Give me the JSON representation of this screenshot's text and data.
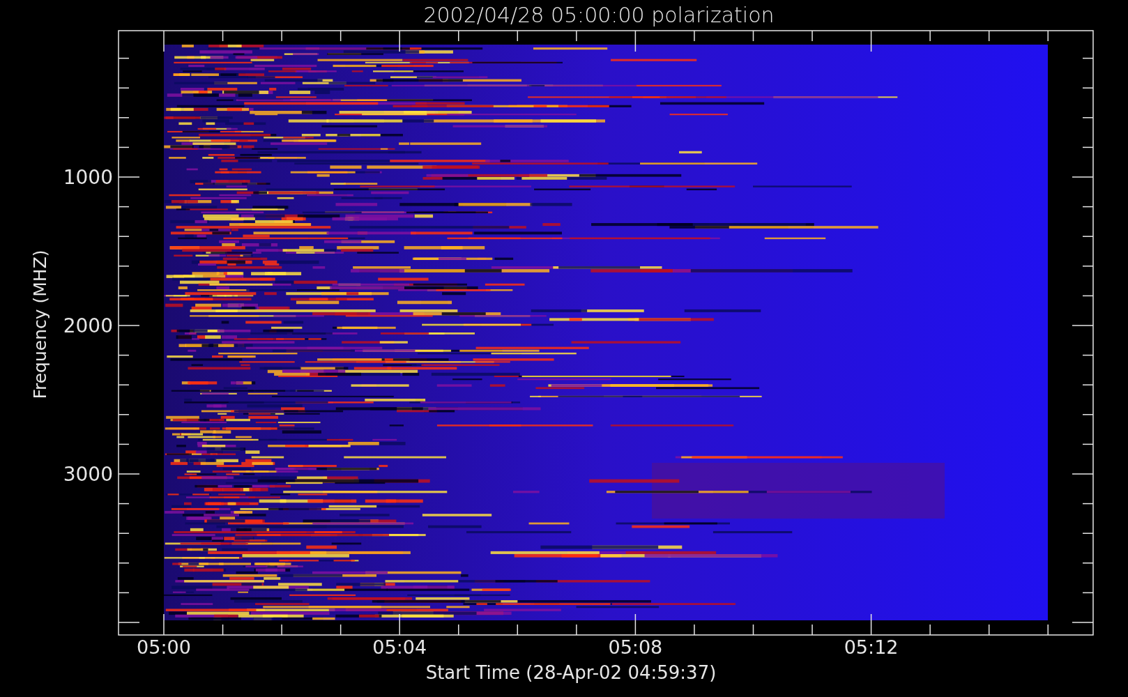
{
  "title": "2002/04/28 05:00:00 polarization",
  "y_axis": {
    "label": "Frequency (MHZ)",
    "ticks": [
      "1000",
      "2000",
      "3000"
    ]
  },
  "x_axis": {
    "label": "Start Time (28-Apr-02 04:59:37)",
    "ticks": [
      "05:00",
      "05:04",
      "05:08",
      "05:12"
    ]
  }
}
